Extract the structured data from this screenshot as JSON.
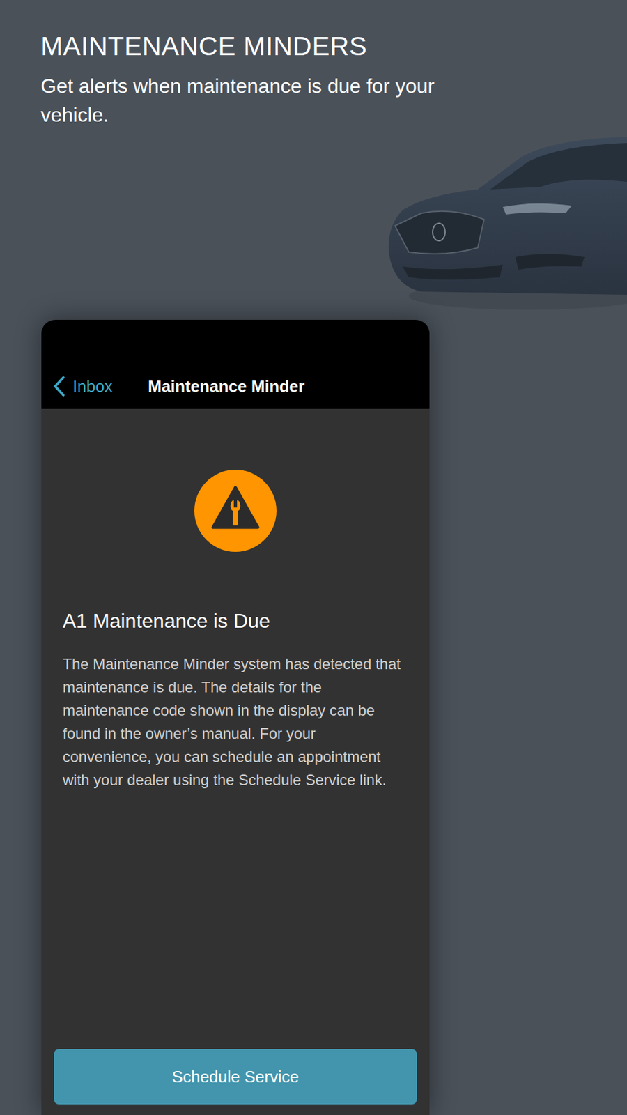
{
  "page": {
    "title": "MAINTENANCE MINDERS",
    "subtitle": "Get alerts when maintenance is due for your vehicle."
  },
  "phone": {
    "nav": {
      "back_label": "Inbox",
      "title": "Maintenance Minder"
    },
    "alert": {
      "title": "A1 Maintenance is Due",
      "body": "The Maintenance Minder system has detected that maintenance is due. The details for the maintenance code shown in the display can be found in the owner’s manual. For your convenience, you can schedule an appointment with your dealer using the Schedule Service link."
    },
    "button": "Schedule Service"
  }
}
